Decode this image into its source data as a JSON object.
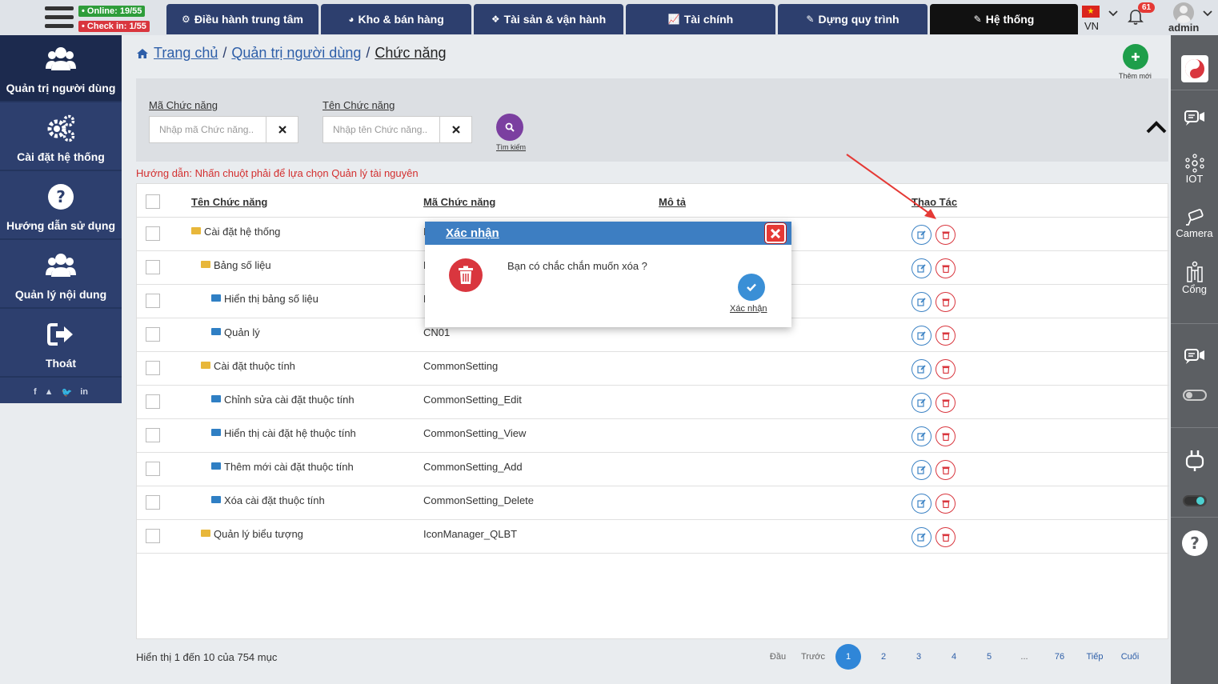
{
  "header": {
    "online": "• Online: 19/55",
    "checkin": "• Check in: 1/55",
    "tabs": [
      {
        "label": "Điều hành trung tâm",
        "icon": "gear-icon"
      },
      {
        "label": "Kho & bán hàng",
        "icon": "pie-chart-icon"
      },
      {
        "label": "Tài sản & vận hành",
        "icon": "cubes-icon"
      },
      {
        "label": "Tài chính",
        "icon": "line-chart-icon"
      },
      {
        "label": "Dựng quy trình",
        "icon": "edit-icon"
      },
      {
        "label": "Hệ thống",
        "icon": "edit-icon"
      }
    ],
    "language": "VN",
    "notifications": "61",
    "user": "admin"
  },
  "sidebar": {
    "items": [
      {
        "label": "Quản trị người dùng",
        "icon": "users-icon"
      },
      {
        "label": "Cài đặt hệ thống",
        "icon": "gears-icon"
      },
      {
        "label": "Hướng dẫn sử dụng",
        "icon": "question-icon"
      },
      {
        "label": "Quản lý nội dung",
        "icon": "users-icon"
      },
      {
        "label": "Thoát",
        "icon": "sign-out-icon"
      }
    ],
    "social": [
      "f",
      "▲",
      "🐦",
      "in"
    ]
  },
  "rail": {
    "items": [
      {
        "label": "",
        "icon": "logo-icon"
      },
      {
        "label": "",
        "icon": "video-chat-icon"
      },
      {
        "label": "IOT",
        "icon": "iot-icon"
      },
      {
        "label": "Camera",
        "icon": "camera-icon"
      },
      {
        "label": "Cổng",
        "icon": "gate-icon"
      }
    ]
  },
  "breadcrumb": {
    "home": "Trang chủ",
    "section": "Quản trị người dùng",
    "current": "Chức năng",
    "separator": "/"
  },
  "actions": {
    "add_label": "Thêm mới"
  },
  "filter": {
    "code_label": "Mã Chức năng",
    "code_placeholder": "Nhập mã Chức năng..",
    "name_label": "Tên Chức năng",
    "name_placeholder": "Nhập tên Chức năng..",
    "search_label": "Tìm kiếm"
  },
  "hint": "Hướng dẫn: Nhấn chuột phải để lựa chọn Quản lý tài nguyên",
  "table": {
    "headers": {
      "name": "Tên Chức năng",
      "code": "Mã Chức năng",
      "description": "Mô tả",
      "actions": "Thao Tác"
    },
    "rows": [
      {
        "name": "Cài đặt hệ thống",
        "code": "I",
        "level": 0,
        "folder": "yellow"
      },
      {
        "name": "Bảng số liệu",
        "code": "D",
        "level": 1,
        "folder": "yellow"
      },
      {
        "name": "Hiển thị bảng số liệu",
        "code": "D",
        "level": 2,
        "folder": "blue"
      },
      {
        "name": "Quản lý",
        "code": "CN01",
        "level": 2,
        "folder": "blue"
      },
      {
        "name": "Cài đặt thuộc tính",
        "code": "CommonSetting",
        "level": 1,
        "folder": "yellow"
      },
      {
        "name": "Chỉnh sửa cài đặt thuộc tính",
        "code": "CommonSetting_Edit",
        "level": 2,
        "folder": "blue"
      },
      {
        "name": "Hiển thị cài đặt hệ thuộc tính",
        "code": "CommonSetting_View",
        "level": 2,
        "folder": "blue"
      },
      {
        "name": "Thêm mới cài đặt thuộc tính",
        "code": "CommonSetting_Add",
        "level": 2,
        "folder": "blue"
      },
      {
        "name": "Xóa cài đặt thuộc tính",
        "code": "CommonSetting_Delete",
        "level": 2,
        "folder": "blue"
      },
      {
        "name": "Quản lý biểu tượng",
        "code": "IconManager_QLBT",
        "level": 1,
        "folder": "yellow"
      }
    ]
  },
  "pagination": {
    "info": "Hiển thị 1 đến 10 của 754 mục",
    "first": "Đầu",
    "prev": "Trước",
    "pages": [
      "1",
      "2",
      "3",
      "4",
      "5",
      "...",
      "76"
    ],
    "next": "Tiếp",
    "last": "Cuối",
    "current": "1"
  },
  "modal": {
    "title": "Xác nhận",
    "message": "Bạn có chắc chắn muốn xóa ?",
    "confirm_label": "Xác nhận"
  },
  "colors": {
    "nav": "#2d3f6e",
    "active_tab": "#111111",
    "modal_header": "#3d7ec2",
    "danger": "#d9363e",
    "success": "#1e9e4a",
    "annotation_arrow": "#e53935"
  }
}
